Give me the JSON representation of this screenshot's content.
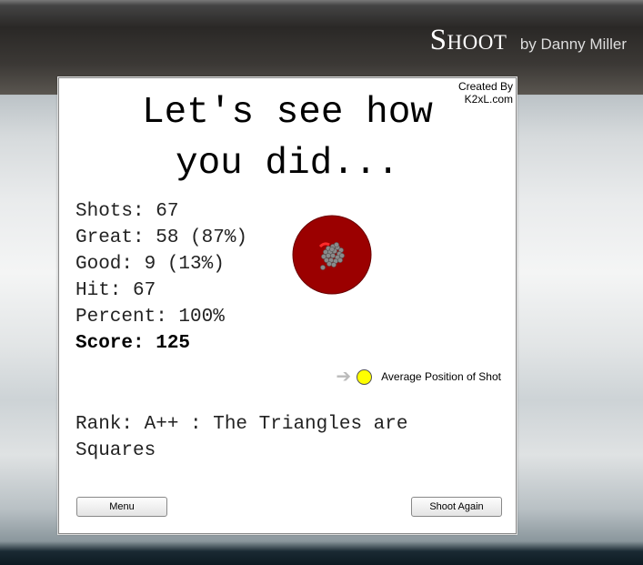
{
  "header": {
    "title": "Shoot",
    "author": "by Danny Miller"
  },
  "credit": {
    "line1": "Created By",
    "line2": "K2xL.com"
  },
  "results": {
    "heading_line1": "Let's see how",
    "heading_line2": "you did...",
    "shots": "Shots: 67",
    "great": "Great: 58 (87%)",
    "good": "Good: 9 (13%)",
    "hit": "Hit: 67",
    "percent": "Percent: 100%",
    "score": "Score: 125",
    "rank_line1": "Rank: A++ : The Triangles are",
    "rank_line2": "Squares"
  },
  "legend": {
    "label": "Average Position of Shot",
    "icon": "arrow-right-icon"
  },
  "buttons": {
    "menu": "Menu",
    "shoot_again": "Shoot Again"
  },
  "colors": {
    "target": "#9b0000",
    "average_marker": "#ffff00",
    "shot": "#888888"
  }
}
